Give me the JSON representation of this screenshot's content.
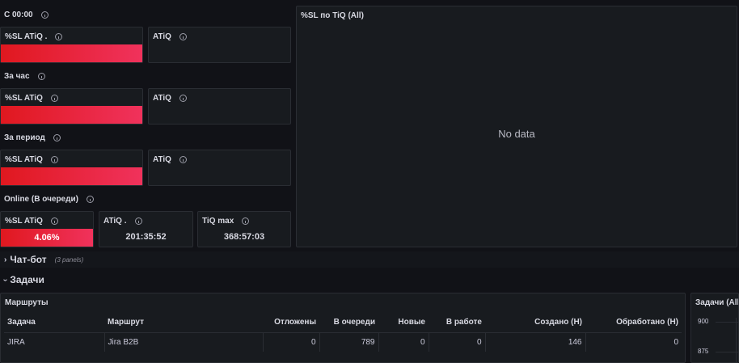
{
  "groups": [
    {
      "title": "С 00:00"
    },
    {
      "title": "За час"
    },
    {
      "title": "За период"
    },
    {
      "title": "Online (В очереди)"
    }
  ],
  "panels": {
    "sl1": {
      "title": "%SL ATiQ ."
    },
    "at1": {
      "title": "ATiQ"
    },
    "sl2": {
      "title": "%SL ATiQ"
    },
    "at2": {
      "title": "ATiQ"
    },
    "sl3": {
      "title": "%SL ATiQ"
    },
    "at3": {
      "title": "ATiQ"
    },
    "sl4": {
      "title": "%SL ATiQ",
      "value": "4.06%"
    },
    "at4": {
      "title": "ATiQ .",
      "value": "201:35:52"
    },
    "tiq": {
      "title": "TiQ max",
      "value": "368:57:03"
    }
  },
  "big_panel": {
    "title": "%SL по TiQ (All)",
    "message": "No data"
  },
  "rows": [
    {
      "title": "Чат-бот",
      "sub": "(3 panels)",
      "chevron": "›"
    },
    {
      "title": "Задачи",
      "chevron": "›"
    }
  ],
  "routes": {
    "title": "Маршруты",
    "columns": [
      "Задача",
      "Маршрут",
      "Отложены",
      "В очереди",
      "Новые",
      "В работе",
      "Создано (Н)",
      "Обработано (Н)"
    ],
    "rows": [
      [
        "JIRA",
        "Jira B2B",
        "0",
        "789",
        "0",
        "0",
        "146",
        "0"
      ]
    ]
  },
  "tasks_panel": {
    "title": "Задачи (All",
    "ticks": [
      "900",
      "875"
    ]
  },
  "colors": {
    "background": "#111217",
    "panel": "#181b1f",
    "bar_start": "#e0181f",
    "bar_end": "#f0325c"
  }
}
